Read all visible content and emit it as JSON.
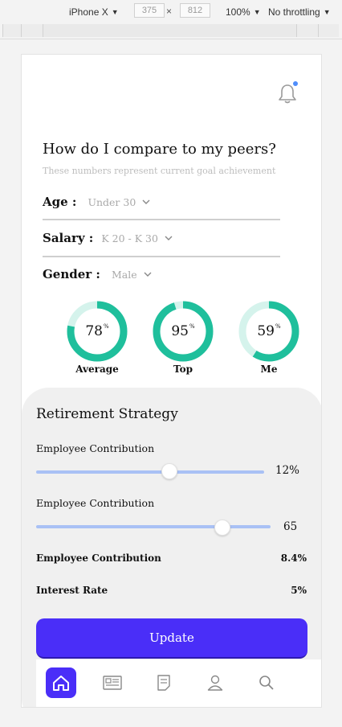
{
  "devtools": {
    "device": "iPhone X",
    "width": "375",
    "height": "812",
    "zoom": "100%",
    "throttle": "No throttling"
  },
  "header": {
    "title": "How do I compare to my peers?",
    "subtitle": "These numbers represent current goal achievement"
  },
  "filters": {
    "age": {
      "label": "Age :",
      "value": "Under 30"
    },
    "salary": {
      "label": "Salary :",
      "value": "K 20 - K 30"
    },
    "gender": {
      "label": "Gender :",
      "value": "Male"
    }
  },
  "rings": [
    {
      "label": "Average",
      "value": "78",
      "unit": "%",
      "percent": 78
    },
    {
      "label": "Top",
      "value": "95",
      "unit": "%",
      "percent": 95
    },
    {
      "label": "Me",
      "value": "59",
      "unit": "%",
      "percent": 59
    }
  ],
  "retirement": {
    "title": "Retirement Strategy",
    "slider1": {
      "label": "Employee Contribution",
      "value": "12%",
      "fraction": 0.58
    },
    "slider2": {
      "label": "Employee Contribution",
      "value": "65",
      "fraction": 0.79
    },
    "row1": {
      "label": "Employee Contribution",
      "value": "8.4%"
    },
    "row2": {
      "label": "Interest Rate",
      "value": "5%"
    },
    "button": "Update"
  },
  "tabs": [
    "home-icon",
    "news-icon",
    "notes-icon",
    "profile-icon",
    "search-icon"
  ],
  "colors": {
    "accent": "#4a2ef8",
    "ring": "#1fbf9c",
    "ring_track": "#d5f3ec",
    "slider": "#a9c1f5",
    "notify": "#4f8dfb"
  }
}
